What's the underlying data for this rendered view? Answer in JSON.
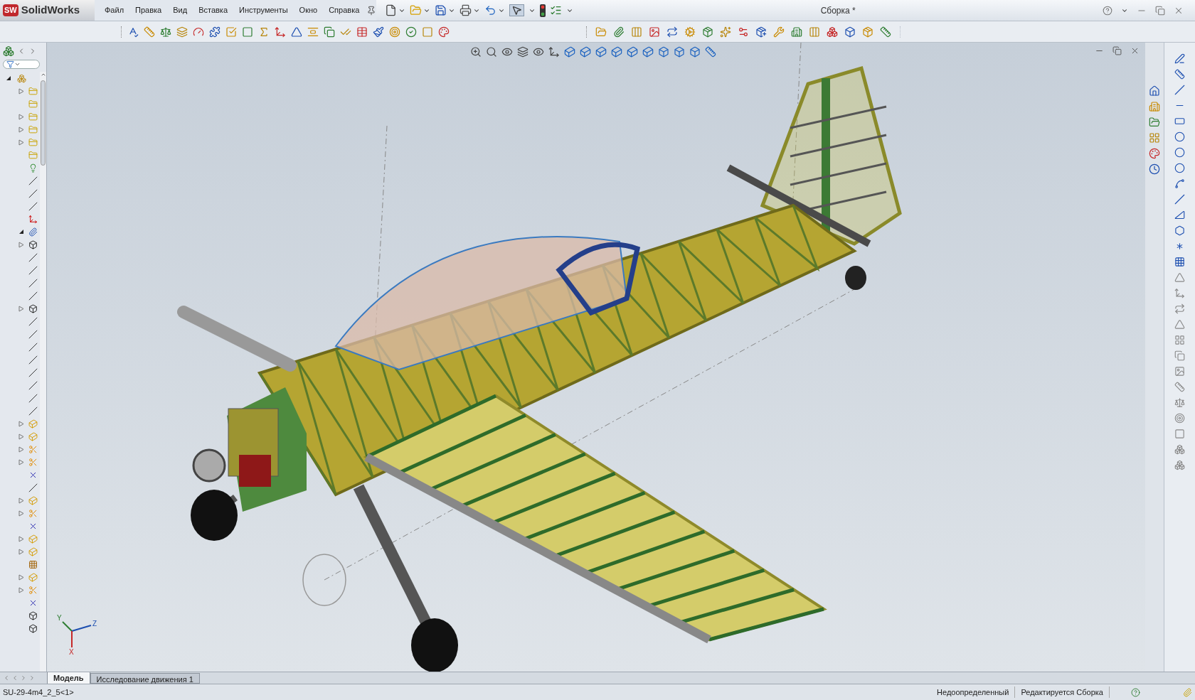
{
  "app": {
    "logo_badge": "SW",
    "logo": "SolidWorks"
  },
  "menu": [
    "Файл",
    "Правка",
    "Вид",
    "Вставка",
    "Инструменты",
    "Окно",
    "Справка"
  ],
  "window": {
    "title": "Сборка *"
  },
  "feature_tree": {
    "root": {
      "kind": "assembly",
      "expanded": true,
      "children": [
        {
          "kind": "folder",
          "expanded": false
        },
        {
          "kind": "folder"
        },
        {
          "kind": "folder",
          "expanded": false
        },
        {
          "kind": "folder",
          "expanded": false
        },
        {
          "kind": "folder",
          "expanded": false
        },
        {
          "kind": "folder"
        },
        {
          "kind": "lights"
        },
        {
          "kind": "plane"
        },
        {
          "kind": "plane"
        },
        {
          "kind": "plane"
        },
        {
          "kind": "origin"
        },
        {
          "kind": "mates",
          "expanded": true
        },
        {
          "kind": "part",
          "expanded": false
        },
        {
          "kind": "plane"
        },
        {
          "kind": "plane"
        },
        {
          "kind": "plane"
        },
        {
          "kind": "plane"
        },
        {
          "kind": "part",
          "expanded": false
        },
        {
          "kind": "plane"
        },
        {
          "kind": "plane"
        },
        {
          "kind": "plane"
        },
        {
          "kind": "plane"
        },
        {
          "kind": "plane"
        },
        {
          "kind": "plane"
        },
        {
          "kind": "plane"
        },
        {
          "kind": "plane"
        },
        {
          "kind": "feature",
          "expanded": false
        },
        {
          "kind": "feature",
          "expanded": false
        },
        {
          "kind": "cut",
          "expanded": false
        },
        {
          "kind": "cut",
          "expanded": false
        },
        {
          "kind": "axis"
        },
        {
          "kind": "plane"
        },
        {
          "kind": "feature",
          "expanded": false
        },
        {
          "kind": "cut",
          "expanded": false
        },
        {
          "kind": "axis"
        },
        {
          "kind": "feature",
          "expanded": false
        },
        {
          "kind": "feature",
          "expanded": false
        },
        {
          "kind": "pattern"
        },
        {
          "kind": "feature",
          "expanded": false
        },
        {
          "kind": "cut",
          "expanded": false
        },
        {
          "kind": "axis"
        },
        {
          "kind": "part"
        },
        {
          "kind": "part"
        }
      ]
    }
  },
  "axis_triad": {
    "labels": [
      "Y",
      "Z",
      "X"
    ]
  },
  "bottom_tabs": [
    {
      "label": "Модель",
      "selected": true
    },
    {
      "label": "Исследование движения 1",
      "selected": false
    }
  ],
  "status_bar": {
    "document": "SU-29-4m4_2_5<1>",
    "status": "Недоопределенный",
    "mode": "Редактируется Сборка"
  }
}
